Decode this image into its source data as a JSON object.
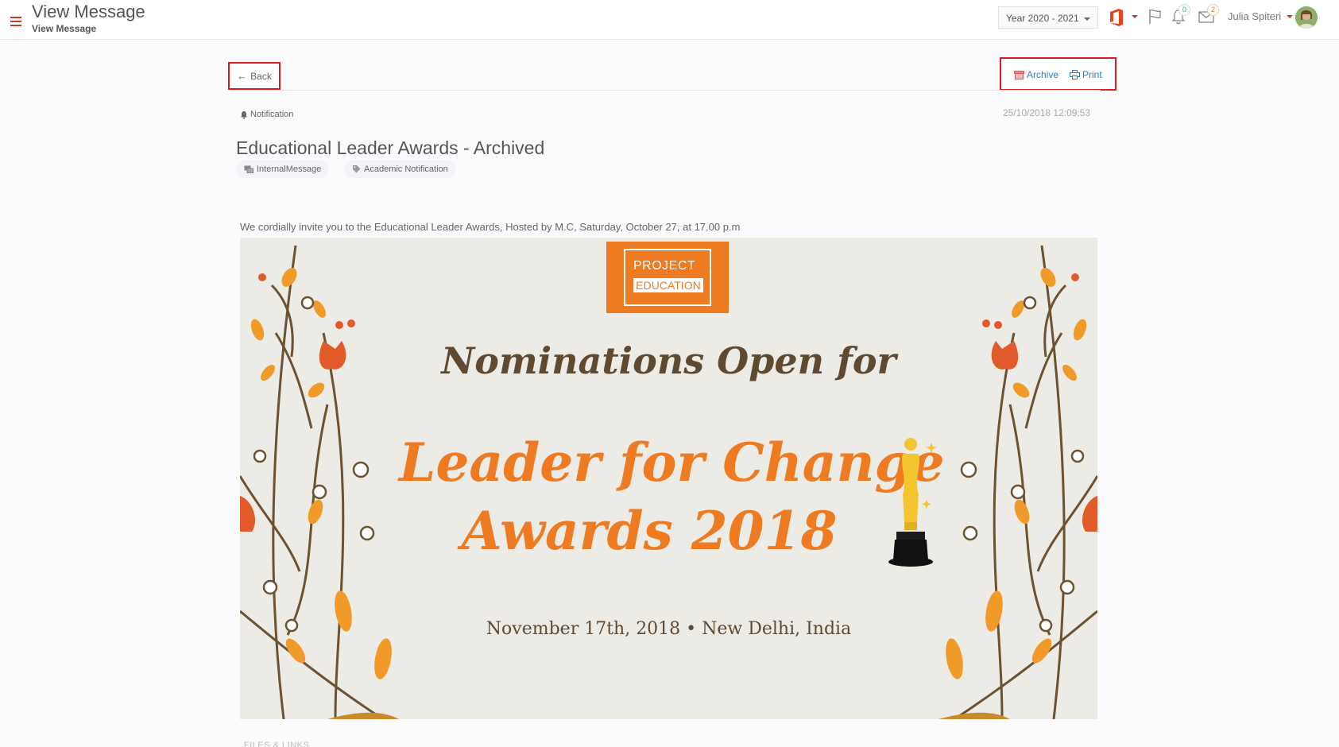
{
  "header": {
    "title": "View Message",
    "subtitle": "View Message",
    "year_select": "Year 2020 - 2021",
    "notifications_count": "0",
    "messages_count": "2",
    "user_name": "Julia Spiteri",
    "icons": [
      "menu-icon",
      "office-icon",
      "flag-icon",
      "bell-icon",
      "mail-icon"
    ]
  },
  "toolbar": {
    "back_label": "Back",
    "archive_label": "Archive",
    "print_label": "Print"
  },
  "message": {
    "type": "Notification",
    "timestamp": "25/10/2018 12:09:53",
    "title": "Educational Leader Awards - Archived",
    "tags": [
      "InternalMessage",
      "Academic Notification"
    ],
    "body": "We cordially invite you to the Educational Leader Awards, Hosted by M.C, Saturday, October 27, at 17.00 p.m"
  },
  "poster": {
    "logo_line1": "PROJECT",
    "logo_line2": "EDUCATION",
    "headline_1": "Nominations Open for",
    "headline_2": "Leader for Change",
    "headline_3": "Awards 2018",
    "event_line": "November 17th, 2018 • New Delhi, India",
    "colors": {
      "orange": "#ee7a22",
      "brown": "#5f4a31",
      "background": "#ecebe6",
      "gold": "#f4c531"
    }
  },
  "files_section_label": "FILES & LINKS",
  "colors": {
    "accent_red": "#e01a22",
    "link_blue": "#2a7ec4"
  }
}
